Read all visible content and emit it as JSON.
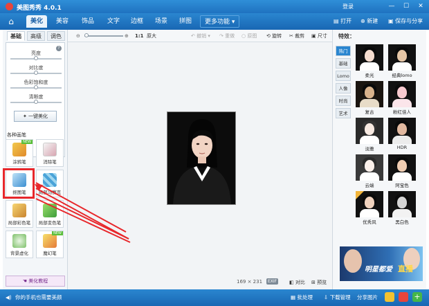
{
  "titlebar": {
    "app_name": "美图秀秀 4.0.1",
    "login": "登录",
    "minimize": "—",
    "maximize": "☐",
    "close": "✕"
  },
  "tabs": [
    "美化",
    "美容",
    "饰品",
    "文字",
    "边框",
    "场景",
    "拼图"
  ],
  "more_features": "更多功能",
  "top_actions": {
    "open": "打开",
    "new": "新建",
    "save": "保存与分享"
  },
  "left_panel": {
    "subtabs": [
      "基础",
      "高级",
      "调色"
    ],
    "sliders": [
      {
        "label": "亮度",
        "value": 0.5
      },
      {
        "label": "对比度",
        "value": 0.5
      },
      {
        "label": "色彩饱和度",
        "value": 0.5
      },
      {
        "label": "清晰度",
        "value": 0.5
      }
    ],
    "one_key_button": "一键美化",
    "section_title": "各种画笔",
    "tools": [
      "涂鸦笔",
      "消除笔",
      "抠图笔",
      "局部马赛克",
      "局部彩色笔",
      "局部变色笔",
      "背景虚化",
      "魔幻笔"
    ],
    "tool_badge": "NEW",
    "tutorial": "美化教程"
  },
  "toolbar": {
    "ratio": "1:1",
    "original_size": "原大",
    "undo": "撤销",
    "redo": "重做",
    "reset": "原图",
    "rotate": "旋转",
    "crop": "裁剪",
    "resize": "尺寸"
  },
  "status": {
    "size": "169 × 231",
    "exif": "EXIF",
    "compare": "对比",
    "preview": "预览"
  },
  "right_panel": {
    "title": "特效：",
    "categories": [
      "热门",
      "基础",
      "Lomo",
      "人像",
      "时尚",
      "艺术"
    ],
    "effects": [
      "柔光",
      "经典lomo",
      "复古",
      "粉红佳人",
      "淡雅",
      "HDR",
      "云端",
      "阿宝色",
      "优秀风",
      "黑白色"
    ],
    "ad_text_1": "明星都爱",
    "ad_text_2": "直播"
  },
  "bottom": {
    "phone_text": "你的手机也需要美颜",
    "batch": "批处理",
    "download": "下载管理",
    "share": "分享图片"
  },
  "colors": {
    "brand_blue": "#1f72c0",
    "annotation_red": "#e8272b"
  }
}
